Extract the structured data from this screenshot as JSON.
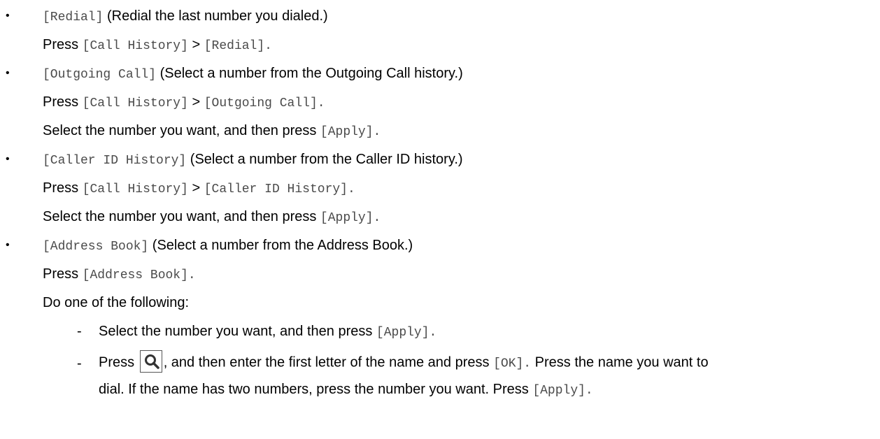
{
  "items": [
    {
      "bullet": "•",
      "option_label": "[Redial]",
      "option_desc": "(Redial the last number you dialed.)",
      "press_word": "Press",
      "path_a": "[Call History]",
      "arrow": ">",
      "path_b": "[Redial].",
      "select_line": null
    },
    {
      "bullet": "•",
      "option_label": "[Outgoing Call]",
      "option_desc": "(Select a number from the Outgoing Call history.)",
      "press_word": "Press",
      "path_a": "[Call History]",
      "arrow": ">",
      "path_b": "[Outgoing Call]."
    },
    {
      "bullet": "•",
      "option_label": "[Caller ID History]",
      "option_desc": "(Select a number from the Caller ID history.)",
      "press_word": "Press",
      "path_a": "[Call History]",
      "arrow": ">",
      "path_b": "[Caller ID History]."
    },
    {
      "bullet": "•",
      "option_label": "[Address Book]",
      "option_desc": "(Select a number from the Address Book.)",
      "press_word": "Press",
      "path_a": "[Address Book]."
    }
  ],
  "select_text": "Select the number you want, and then press",
  "apply_label": "[Apply].",
  "do_one": "Do one of the following:",
  "dash": "-",
  "sub": {
    "press_word": "Press",
    "search_icon": "magnifier-icon",
    "after_icon": ", and then enter the first letter of the name and press",
    "ok_label": "[OK].",
    "after_ok": "Press the name you want to",
    "line2": "dial. If the name has two numbers, press the number you want. Press",
    "apply_label": "[Apply]."
  }
}
